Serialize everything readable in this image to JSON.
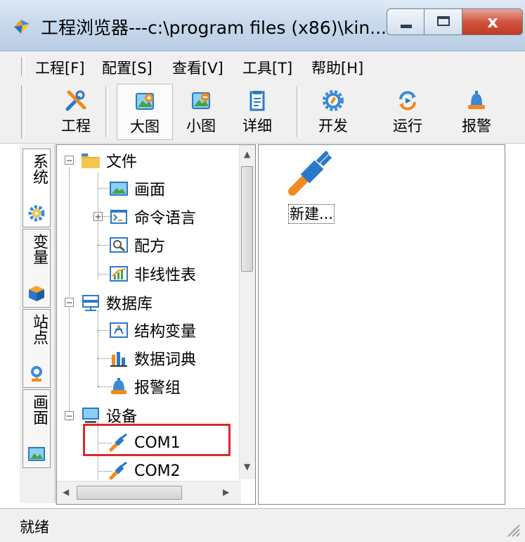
{
  "window": {
    "title": "工程浏览器---c:\\program files (x86)\\kin...",
    "close_label": "x"
  },
  "menu": [
    {
      "label": "工程[F]"
    },
    {
      "label": "配置[S]"
    },
    {
      "label": "查看[V]"
    },
    {
      "label": "工具[T]"
    },
    {
      "label": "帮助[H]"
    }
  ],
  "toolbar": [
    {
      "label": "工程",
      "icon": "wrench-screwdriver-icon"
    },
    {
      "label": "大图",
      "icon": "large-icons-icon"
    },
    {
      "label": "小图",
      "icon": "small-icons-icon"
    },
    {
      "label": "详细",
      "icon": "details-icon"
    },
    {
      "label": "开发",
      "icon": "develop-gear-icon"
    },
    {
      "label": "运行",
      "icon": "run-icon"
    },
    {
      "label": "报警",
      "icon": "alarm-bell-icon"
    }
  ],
  "side_tabs": [
    {
      "label": "系统",
      "icon": "gear-icon"
    },
    {
      "label": "变量",
      "icon": "cube-icon"
    },
    {
      "label": "站点",
      "icon": "station-icon"
    },
    {
      "label": "画面",
      "icon": "picture-icon"
    }
  ],
  "tree": {
    "file": "文件",
    "screen": "画面",
    "command": "命令语言",
    "recipe": "配方",
    "nonlinear": "非线性表",
    "database": "数据库",
    "struct_var": "结构变量",
    "dictionary": "数据词典",
    "alarm_group": "报警组",
    "device": "设备",
    "com1": "COM1",
    "com2": "COM2",
    "expand_minus": "−",
    "expand_plus": "+"
  },
  "content": {
    "new_label": "新建..."
  },
  "status": {
    "text": "就绪"
  },
  "colors": {
    "selection_highlight": "#d82a2a",
    "folder": "#f0b33a",
    "icon_blue": "#2a79c9"
  }
}
